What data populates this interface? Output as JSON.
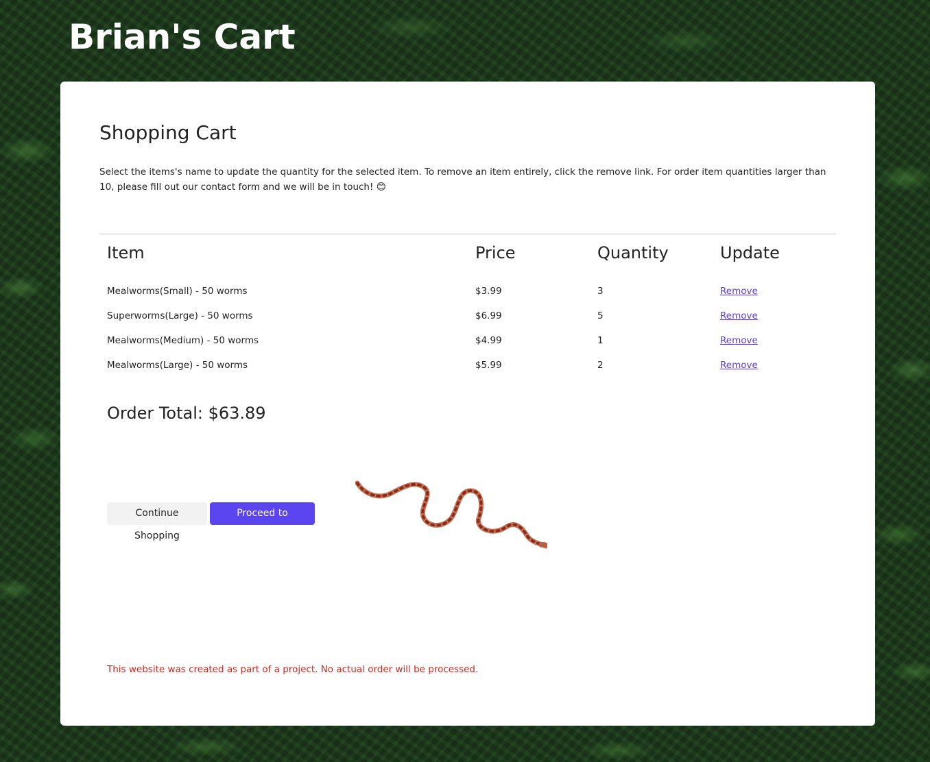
{
  "header": {
    "brand": "Brian's Cart"
  },
  "cart": {
    "title": "Shopping Cart",
    "instructions": "Select the items's name to update the quantity for the selected item. To remove an item entirely, click the remove link. For order item quantities larger than 10, please fill out our contact form and we will be in touch! 😊",
    "columns": [
      "Item",
      "Price",
      "Quantity",
      "Update"
    ],
    "items": [
      {
        "name": "Mealworms(Small) - 50 worms",
        "price": "$3.99",
        "quantity": "3",
        "action": "Remove"
      },
      {
        "name": "Superworms(Large) - 50 worms",
        "price": "$6.99",
        "quantity": "5",
        "action": "Remove"
      },
      {
        "name": "Mealworms(Medium) - 50 worms",
        "price": "$4.99",
        "quantity": "1",
        "action": "Remove"
      },
      {
        "name": "Mealworms(Large) - 50 worms",
        "price": "$5.99",
        "quantity": "2",
        "action": "Remove"
      }
    ],
    "order_total": "Order Total: $63.89"
  },
  "actions": {
    "continue_label": "Continue Shopping",
    "proceed_label": "Proceed to Shipping"
  },
  "footer": {
    "disclaimer": "This website was created as part of a project. No actual order will be processed."
  },
  "colors": {
    "primary": "#5a45f0",
    "link": "#5b3fd0",
    "disclaimer": "#c8281e",
    "background": "#1e3a1e"
  },
  "icons": {
    "decoration": "snake-image"
  }
}
